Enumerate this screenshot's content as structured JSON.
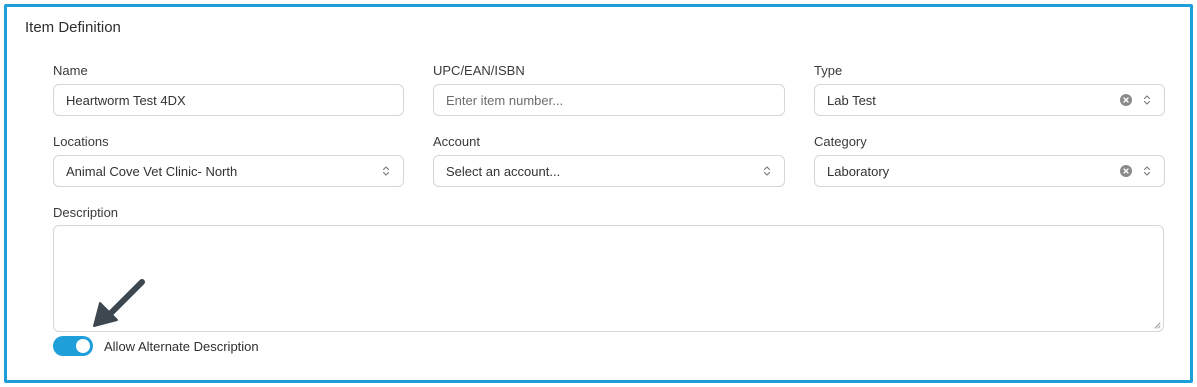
{
  "section": {
    "title": "Item Definition"
  },
  "fields": {
    "name": {
      "label": "Name",
      "value": "Heartworm Test 4DX"
    },
    "upc": {
      "label": "UPC/EAN/ISBN",
      "placeholder": "Enter item number..."
    },
    "type": {
      "label": "Type",
      "value": "Lab Test"
    },
    "locations": {
      "label": "Locations",
      "value": "Animal Cove Vet Clinic- North"
    },
    "account": {
      "label": "Account",
      "placeholder": "Select an account..."
    },
    "category": {
      "label": "Category",
      "value": "Laboratory"
    },
    "description": {
      "label": "Description",
      "value": ""
    }
  },
  "toggle": {
    "label": "Allow Alternate Description",
    "on": true
  },
  "icons": {
    "select_chevron": "chevron-updown-icon",
    "clear": "clear-x-icon",
    "annotation": "pointer-arrow-icon",
    "resize": "resize-grip-icon"
  },
  "colors": {
    "accent": "#1e9fd9",
    "border": "#d6d6d6",
    "arrow": "#3d4750"
  }
}
